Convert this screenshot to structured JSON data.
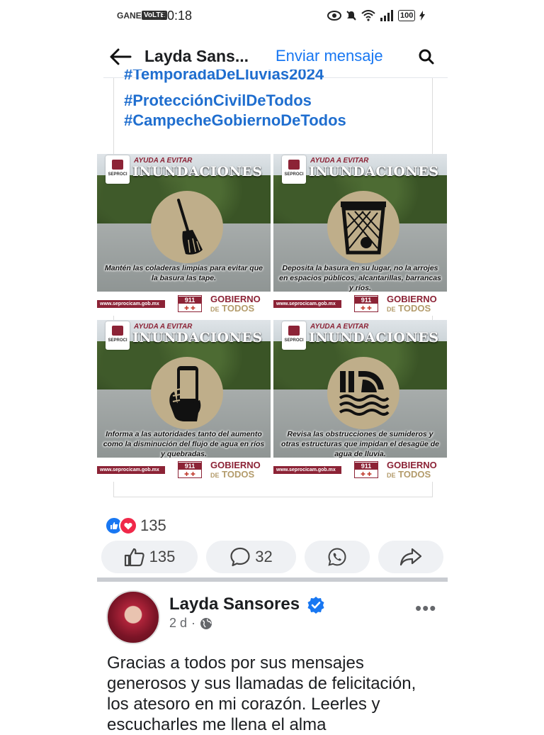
{
  "status_bar": {
    "carrier": "GANE",
    "volte": "VoLTE",
    "time": "10:18",
    "battery": "100"
  },
  "header": {
    "title": "Layda Sans...",
    "send_message": "Enviar mensaje"
  },
  "post": {
    "hashtags": [
      "#TemporadaDeLluvias2024",
      "#ProtecciónCivilDeTodos",
      "#CampecheGobiernoDeTodos"
    ],
    "infographics": [
      {
        "ayuda": "AYUDA A EVITAR",
        "heading": "INUNDACIONES",
        "icon": "broom-icon",
        "caption": "Mantén las coladeras limpias para evitar que la basura las tape.",
        "url": "www.seprocicam.gob.mx",
        "emergency": "911",
        "gobierno": "GOBIERNO",
        "de": "DE",
        "todos": "TODOS",
        "logo_text": "SEPROCI"
      },
      {
        "ayuda": "AYUDA A EVITAR",
        "heading": "INUNDACIONES",
        "icon": "trash-bin-icon",
        "caption": "Deposita la basura en su lugar, no la arrojes en espacios públicos, alcantarillas, barrancas y ríos.",
        "url": "www.seprocicam.gob.mx",
        "emergency": "911",
        "gobierno": "GOBIERNO",
        "de": "DE",
        "todos": "TODOS",
        "logo_text": "SEPROCI"
      },
      {
        "ayuda": "AYUDA A EVITAR",
        "heading": "INUNDACIONES",
        "icon": "phone-hand-icon",
        "caption": "Informa a las autoridades tanto del aumento como la disminución del flujo de agua en ríos y quebradas.",
        "url": "www.seprocicam.gob.mx",
        "emergency": "911",
        "gobierno": "GOBIERNO",
        "de": "DE",
        "todos": "TODOS",
        "logo_text": "SEPROCI"
      },
      {
        "ayuda": "AYUDA A EVITAR",
        "heading": "INUNDACIONES",
        "icon": "drain-pipe-icon",
        "caption": "Revisa las obstrucciones de sumideros y otras estructuras que impidan el desagüe de agua de lluvia.",
        "url": "www.seprocicam.gob.mx",
        "emergency": "911",
        "gobierno": "GOBIERNO",
        "de": "DE",
        "todos": "TODOS",
        "logo_text": "SEPROCI"
      }
    ],
    "reaction_count": "135",
    "like_count": "135",
    "comment_count": "32"
  },
  "next_post": {
    "author": "Layda Sansores",
    "time": "2 d",
    "separator": "·",
    "text": "Gracias a todos por sus mensajes generosos y sus llamadas de felicitación, los atesoro en mi corazón. Leerles y escucharles me llena el alma"
  },
  "colors": {
    "link_blue": "#1877f2",
    "hashtag_blue": "#1f6ecf",
    "brand_maroon": "#8c2336",
    "brand_gold": "#b39b6b"
  }
}
